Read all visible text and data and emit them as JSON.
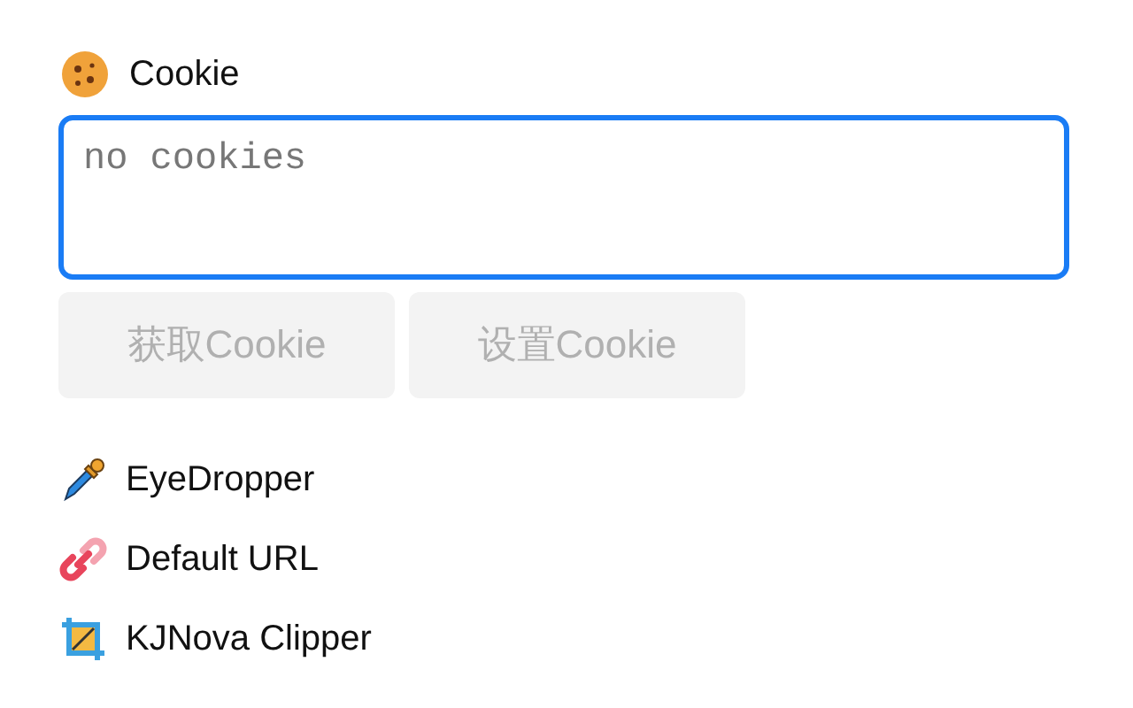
{
  "cookie_section": {
    "title": "Cookie",
    "field": {
      "placeholder": "no cookies",
      "focused": true
    },
    "buttons": [
      {
        "label": "获取Cookie",
        "disabled": true
      },
      {
        "label": "设置Cookie",
        "disabled": true
      }
    ]
  },
  "tools": [
    {
      "kind": "dropper",
      "label": "EyeDropper"
    },
    {
      "kind": "link",
      "label": "Default URL"
    },
    {
      "kind": "crop",
      "label": "KJNova Clipper"
    }
  ]
}
